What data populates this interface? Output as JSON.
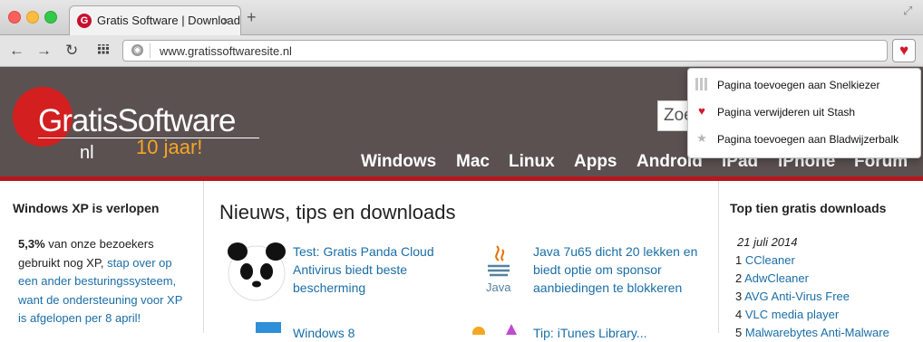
{
  "browser": {
    "tab_title": "Gratis Software | Download",
    "tab_favicon": "G",
    "tab_close": "×",
    "new_tab": "+",
    "address": "www.gratissoftwaresite.nl",
    "stash_icon": "heart-icon"
  },
  "dropdown": {
    "items": [
      {
        "label": "Pagina toevoegen aan Snelkiezer",
        "icon": "speed-dial-icon"
      },
      {
        "label": "Pagina verwijderen uit Stash",
        "icon": "heart-icon"
      },
      {
        "label": "Pagina toevoegen aan Bladwijzerbalk",
        "icon": "star-icon"
      }
    ]
  },
  "site": {
    "logo_main": "GratisSoftware",
    "logo_sub": "nl",
    "logo_anniversary": "10 jaar!",
    "search_placeholder": "Zoe",
    "nav": [
      "Windows",
      "Mac",
      "Linux",
      "Apps",
      "Android",
      "iPad",
      "iPhone",
      "Forum"
    ]
  },
  "left": {
    "heading": "Windows XP is verlopen",
    "pct": "5,3%",
    "text1": " van onze bezoekers gebruikt nog XP, ",
    "link": "stap over op een ander besturingssysteem, want de ondersteuning voor XP is afgelopen per 8 april!"
  },
  "main": {
    "title": "Nieuws, tips en downloads",
    "articles": [
      {
        "title": "Test: Gratis Panda Cloud Antivirus biedt beste bescherming"
      },
      {
        "title": "Java 7u65 dicht 20 lekken en biedt optie om sponsor aanbiedingen te blokkeren"
      }
    ],
    "partial": [
      "Windows 8 ",
      "Tip: iTunes Library..."
    ]
  },
  "right": {
    "heading": "Top tien gratis downloads",
    "date": "21 juli 2014",
    "list": [
      {
        "n": "1",
        "name": "CCleaner"
      },
      {
        "n": "2",
        "name": "AdwCleaner"
      },
      {
        "n": "3",
        "name": "AVG Anti-Virus Free"
      },
      {
        "n": "4",
        "name": "VLC media player"
      },
      {
        "n": "5",
        "name": "Malwarebytes Anti-Malware"
      }
    ]
  }
}
